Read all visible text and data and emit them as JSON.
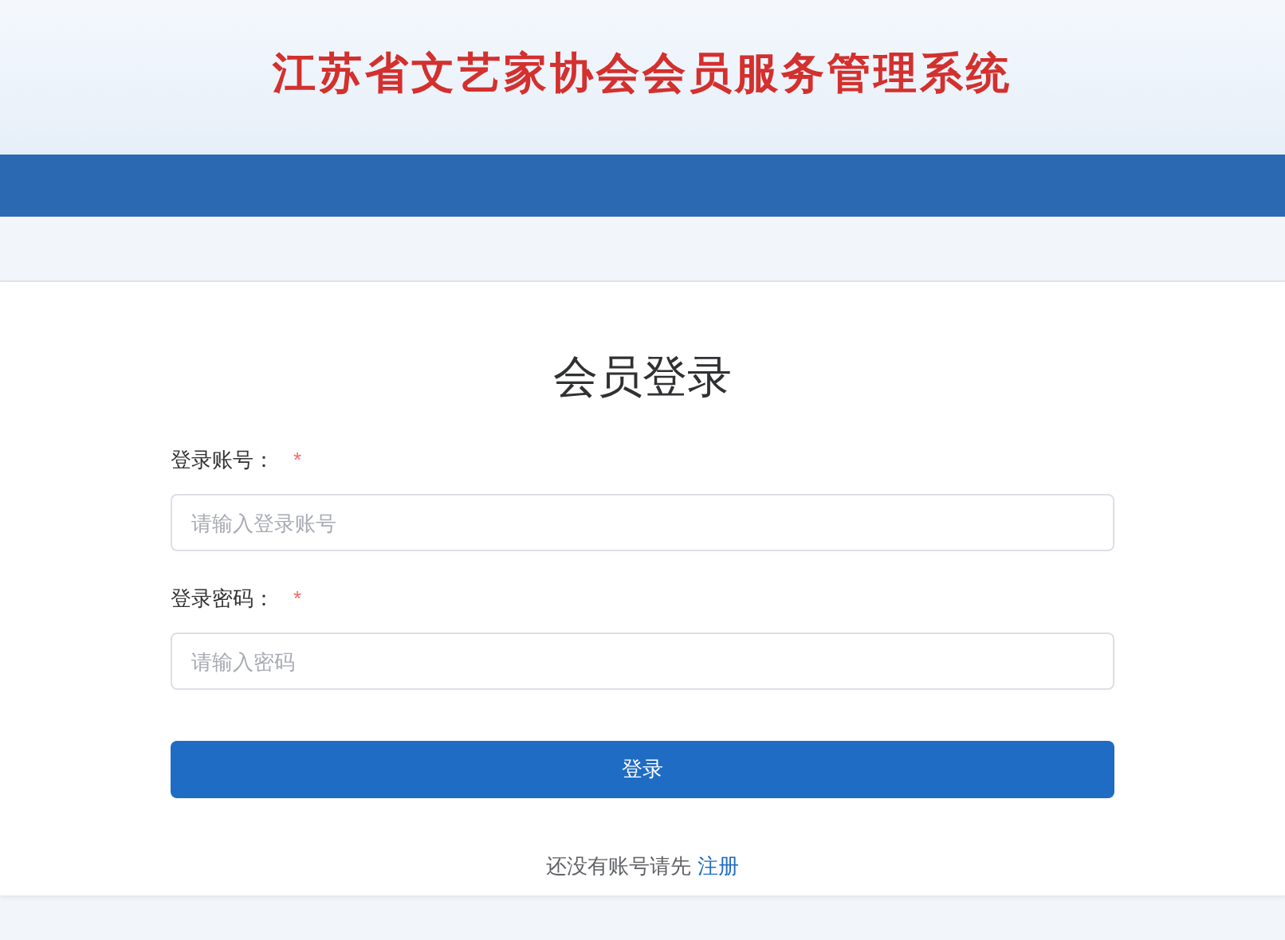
{
  "header": {
    "title": "江苏省文艺家协会会员服务管理系统"
  },
  "login": {
    "heading": "会员登录",
    "fields": [
      {
        "label": "登录账号：",
        "required_mark": "*",
        "placeholder": "请输入登录账号"
      },
      {
        "label": "登录密码：",
        "required_mark": "*",
        "placeholder": "请输入密码"
      }
    ],
    "submit": "登录",
    "register_prompt": "还没有账号请先",
    "register_link": "注册"
  }
}
